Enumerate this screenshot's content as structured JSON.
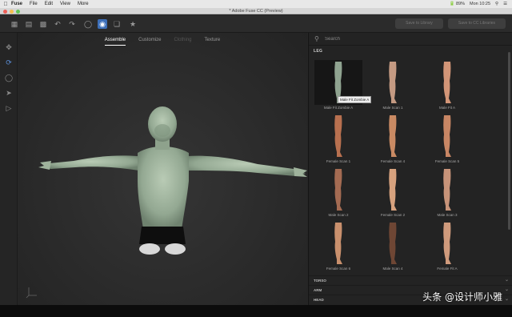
{
  "menubar": {
    "items": [
      "Fuse",
      "File",
      "Edit",
      "View",
      "More"
    ],
    "status_right": "🔋 89%",
    "clock": "Mon 10:25"
  },
  "window": {
    "title": "* Adobe Fuse CC (Preview)"
  },
  "toolbar": {
    "right_buttons": [
      "Save to Library",
      "Save to CC Libraries"
    ]
  },
  "viewport": {
    "tabs": [
      {
        "label": "Assemble",
        "state": "active"
      },
      {
        "label": "Customize",
        "state": "normal"
      },
      {
        "label": "Clothing",
        "state": "disabled"
      },
      {
        "label": "Texture",
        "state": "normal"
      }
    ]
  },
  "library": {
    "search_placeholder": "Search",
    "section": "LEG",
    "tooltip": "Male Fit Zombie A",
    "items": [
      {
        "label": "Male Fit Zombie A",
        "skin": "#8fa390",
        "selected": true
      },
      {
        "label": "Male Scan 1",
        "skin": "#c49a82"
      },
      {
        "label": "Male Fit A",
        "skin": "#d29577"
      },
      {
        "label": "Female Scan 1",
        "skin": "#b8704f"
      },
      {
        "label": "Female Scan 4",
        "skin": "#c98a63"
      },
      {
        "label": "Female Scan 5",
        "skin": "#c88664"
      },
      {
        "label": "Male Scan 2",
        "skin": "#a46b52"
      },
      {
        "label": "Female Scan 2",
        "skin": "#d7a27e"
      },
      {
        "label": "Male Scan 3",
        "skin": "#c79379"
      },
      {
        "label": "Female Scan 6",
        "skin": "#c9906d"
      },
      {
        "label": "Male Scan 4",
        "skin": "#6e4634"
      },
      {
        "label": "Female Fit A",
        "skin": "#cf9a7c"
      }
    ],
    "categories": [
      "TORSO",
      "ARM",
      "HEAD"
    ]
  },
  "watermark": "头条 @设计师小雅",
  "colors": {
    "accent": "#3d6fb8",
    "zombie_skin": "#9db39a"
  }
}
